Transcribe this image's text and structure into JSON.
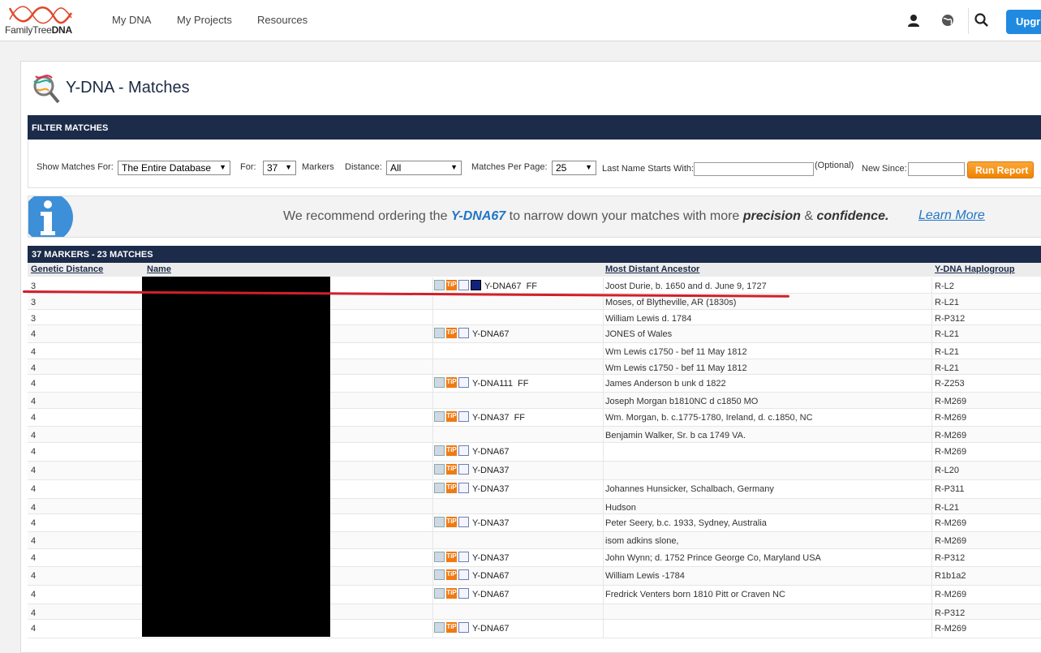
{
  "nav": {
    "logo_text_1": "FamilyTree",
    "logo_text_2": "DNA",
    "links": [
      "My DNA",
      "My Projects",
      "Resources"
    ],
    "upgrade_label": "Upgr"
  },
  "page": {
    "title": "Y-DNA - Matches"
  },
  "filter": {
    "bar_title": "FILTER MATCHES",
    "show_for_label": "Show Matches For:",
    "show_for_value": "The Entire Database",
    "for_label": "For:",
    "markers_value": "37",
    "markers_label": "Markers",
    "distance_label": "Distance:",
    "distance_value": "All",
    "per_page_label": "Matches Per Page:",
    "per_page_value": "25",
    "last_name_label": "Last Name Starts With:",
    "optional_label": "(Optional)",
    "new_since_label": "New Since:",
    "run_label": "Run Report"
  },
  "banner": {
    "text_1": "We recommend ordering the",
    "text_hl": "Y-DNA67",
    "text_2": "to narrow down your matches with more",
    "text_b1": "precision",
    "text_amp": "&",
    "text_b2": "confidence.",
    "learn_more": "Learn More"
  },
  "results": {
    "bar_title": "37 MARKERS - 23 MATCHES",
    "headers": {
      "genetic_distance": "Genetic Distance",
      "name": "Name",
      "ancestor": "Most Distant Ancestor",
      "haplogroup": "Y-DNA Haplogroup"
    },
    "rows": [
      {
        "gd": "3",
        "test": "Y-DNA67  FF",
        "icons": true,
        "tree": true,
        "ancestor": "Joost Durie, b. 1650 and d. June 9, 1727",
        "hap": "R-L2"
      },
      {
        "gd": "3",
        "test": "",
        "icons": false,
        "tree": false,
        "ancestor": "Moses, of Blytheville, AR (1830s)",
        "hap": "R-L21"
      },
      {
        "gd": "3",
        "test": "",
        "icons": false,
        "tree": false,
        "ancestor": "William Lewis d. 1784",
        "hap": "R-P312"
      },
      {
        "gd": "4",
        "test": "Y-DNA67",
        "icons": true,
        "tree": false,
        "ancestor": "JONES of Wales",
        "hap": "R-L21"
      },
      {
        "gd": "4",
        "test": "",
        "icons": false,
        "tree": false,
        "ancestor": "Wm Lewis c1750 - bef 11 May 1812",
        "hap": "R-L21"
      },
      {
        "gd": "4",
        "test": "",
        "icons": false,
        "tree": false,
        "ancestor": "Wm Lewis c1750 - bef 11 May 1812",
        "hap": "R-L21"
      },
      {
        "gd": "4",
        "test": "Y-DNA111  FF",
        "icons": true,
        "tree": false,
        "ancestor": "James Anderson b unk d 1822",
        "hap": "R-Z253"
      },
      {
        "gd": "4",
        "test": "",
        "icons": false,
        "tree": false,
        "ancestor": "Joseph Morgan b1810NC d c1850 MO",
        "hap": "R-M269"
      },
      {
        "gd": "4",
        "test": "Y-DNA37  FF",
        "icons": true,
        "tree": false,
        "ancestor": "Wm. Morgan, b. c.1775-1780, Ireland, d. c.1850, NC",
        "hap": "R-M269"
      },
      {
        "gd": "4",
        "test": "",
        "icons": false,
        "tree": false,
        "ancestor": "Benjamin Walker, Sr. b ca 1749 VA.",
        "hap": "R-M269"
      },
      {
        "gd": "4",
        "test": "Y-DNA67",
        "icons": true,
        "tree": false,
        "ancestor": "",
        "hap": "R-M269"
      },
      {
        "gd": "4",
        "test": "Y-DNA37",
        "icons": true,
        "tree": false,
        "ancestor": "",
        "hap": "R-L20"
      },
      {
        "gd": "4",
        "test": "Y-DNA37",
        "icons": true,
        "tree": false,
        "ancestor": "Johannes Hunsicker, Schalbach, Germany",
        "hap": "R-P311"
      },
      {
        "gd": "4",
        "test": "",
        "icons": false,
        "tree": false,
        "ancestor": "Hudson",
        "hap": "R-L21"
      },
      {
        "gd": "4",
        "test": "Y-DNA37",
        "icons": true,
        "tree": false,
        "ancestor": "Peter Seery, b.c. 1933, Sydney, Australia",
        "hap": "R-M269"
      },
      {
        "gd": "4",
        "test": "",
        "icons": false,
        "tree": false,
        "ancestor": "isom adkins slone,",
        "hap": "R-M269"
      },
      {
        "gd": "4",
        "test": "Y-DNA37",
        "icons": true,
        "tree": false,
        "ancestor": "John Wynn; d. 1752 Prince George Co, Maryland USA",
        "hap": "R-P312"
      },
      {
        "gd": "4",
        "test": "Y-DNA67",
        "icons": true,
        "tree": false,
        "ancestor": "William Lewis -1784",
        "hap": "R1b1a2"
      },
      {
        "gd": "4",
        "test": "Y-DNA67",
        "icons": true,
        "tree": false,
        "ancestor": "Fredrick Venters born 1810 Pitt or Craven NC",
        "hap": "R-M269"
      },
      {
        "gd": "4",
        "test": "",
        "icons": false,
        "tree": false,
        "ancestor": "",
        "hap": "R-P312"
      },
      {
        "gd": "4",
        "test": "Y-DNA67",
        "icons": true,
        "tree": false,
        "ancestor": "",
        "hap": "R-M269"
      }
    ]
  },
  "icons": {
    "user": "user-icon",
    "globe": "globe-icon",
    "search": "search-icon",
    "mail": "mail-icon",
    "tip": "tip-icon",
    "note": "notes-icon",
    "tree": "family-tree-icon"
  }
}
